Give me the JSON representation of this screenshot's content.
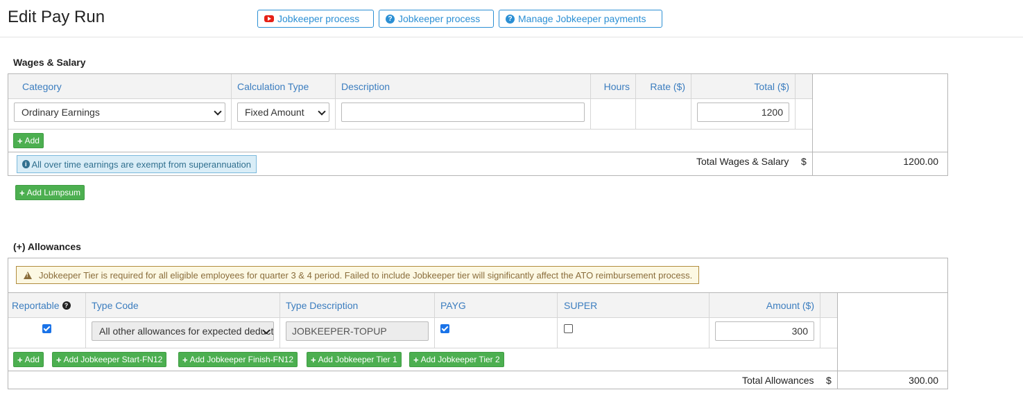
{
  "header": {
    "title": "Edit Pay Run",
    "buttons": [
      {
        "label": "Jobkeeper process",
        "icon": "youtube-icon"
      },
      {
        "label": "Jobkeeper process",
        "icon": "question-circle-icon"
      },
      {
        "label": "Manage Jobkeeper payments",
        "icon": "question-circle-icon"
      }
    ]
  },
  "wages": {
    "title": "Wages & Salary",
    "columns": {
      "category": "Category",
      "calc_type": "Calculation Type",
      "description": "Description",
      "hours": "Hours",
      "rate": "Rate ($)",
      "total": "Total ($)"
    },
    "row": {
      "category": "Ordinary Earnings",
      "calc_type": "Fixed Amount",
      "description": "",
      "hours": "",
      "rate": "",
      "total": "1200"
    },
    "add_label": "Add",
    "info": "All over time earnings are exempt from superannuation",
    "total_label": "Total Wages & Salary",
    "currency": "$",
    "total_value": "1200.00",
    "add_lumpsum_label": "Add Lumpsum"
  },
  "allowances": {
    "title": "(+) Allowances",
    "warning": "Jobkeeper Tier is required for all eligible employees for quarter 3 & 4 period. Failed to include Jobkeeper tier will significantly affect the ATO reimbursement process.",
    "columns": {
      "reportable": "Reportable",
      "type_code": "Type Code",
      "type_description": "Type Description",
      "payg": "PAYG",
      "super": "SUPER",
      "amount": "Amount ($)"
    },
    "row": {
      "reportable": true,
      "type_code": "All other allowances for expected deductions",
      "type_description": "JOBKEEPER-TOPUP",
      "payg": true,
      "super": false,
      "amount": "300"
    },
    "buttons": [
      "Add",
      "Add Jobkeeper Start-FN12",
      "Add Jobkeeper Finish-FN12",
      "Add Jobkeeper Tier 1",
      "Add Jobkeeper Tier 2"
    ],
    "total_label": "Total Allowances",
    "currency": "$",
    "total_value": "300.00"
  },
  "colors": {
    "accent": "#2b8fd4",
    "header_text": "#3b7dbf",
    "green": "#4caf50",
    "info_bg": "#d9edf7",
    "warning_bg": "#fcf8e3"
  }
}
